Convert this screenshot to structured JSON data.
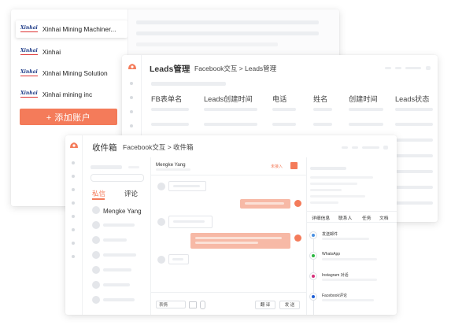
{
  "accounts_card": {
    "accounts": [
      {
        "brand": "Xinhai",
        "name": "Xinhai Mining Machiner..."
      },
      {
        "brand": "Xinhai",
        "name": "Xinhai"
      },
      {
        "brand": "Xinhai",
        "name": "Xinhai Mining Solution"
      },
      {
        "brand": "Xinhai",
        "name": "Xinhai mining inc"
      }
    ],
    "add_button": "+ 添加账户"
  },
  "leads_card": {
    "title": "Leads管理",
    "breadcrumb": "Facebook交互 > Leads管理",
    "columns": [
      "FB表单名",
      "Leads创建时间",
      "电话",
      "姓名",
      "创建时间",
      "Leads状态"
    ]
  },
  "inbox_card": {
    "title": "收件箱",
    "breadcrumb": "Facebook交互 > 收件箱",
    "tabs": {
      "private": "私信",
      "comment": "评论"
    },
    "contact_name": "Mengke Yang",
    "chat": {
      "user": "Mengke Yang",
      "tag": "未接入",
      "select_label": "表情",
      "translate_button": "翻 译",
      "send_button": "发 送"
    },
    "detail_tabs": [
      "详细信息",
      "联系人",
      "任务",
      "文档"
    ],
    "detail_items": [
      {
        "label": "发送邮件",
        "color": "#4a90e2"
      },
      {
        "label": "WhatsApp",
        "color": "#2bb741"
      },
      {
        "label": "Instagram 对话",
        "color": "#d6307a"
      },
      {
        "label": "Facebook评论",
        "color": "#1f5fd6"
      }
    ]
  },
  "colors": {
    "accent": "#f47b5a",
    "brand_blue": "#1f3c88"
  }
}
